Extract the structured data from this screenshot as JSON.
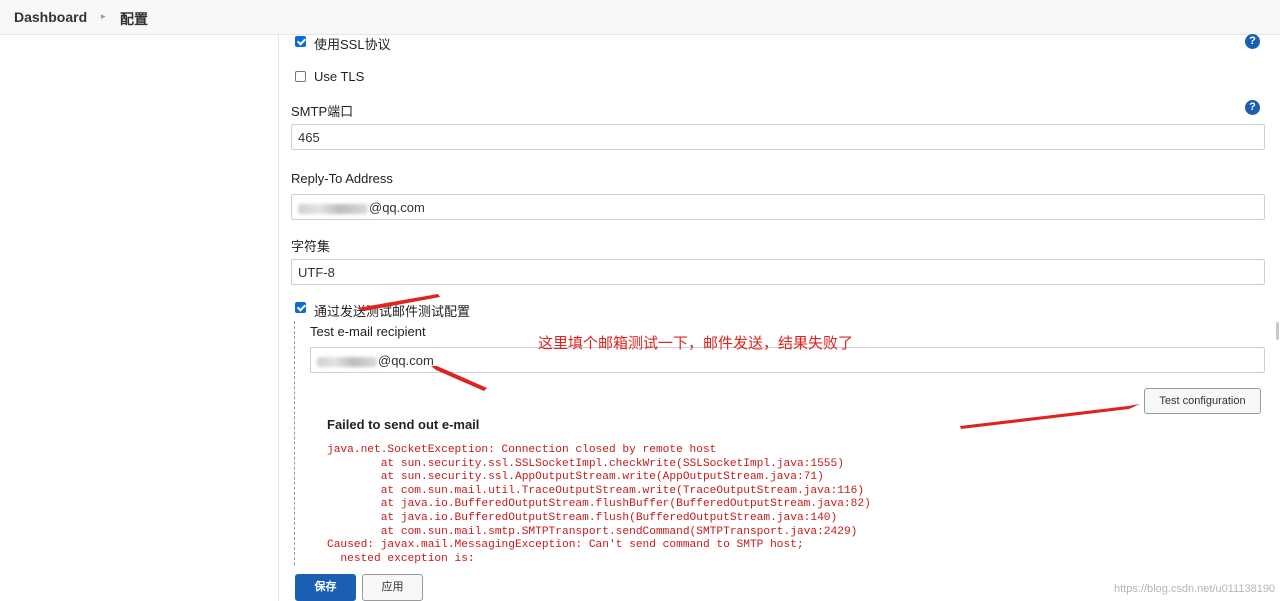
{
  "breadcrumb": {
    "dashboard": "Dashboard",
    "page": "配置"
  },
  "form": {
    "use_ssl_label": "使用SSL协议",
    "use_tls_label": "Use TLS",
    "smtp_port_label": "SMTP端口",
    "smtp_port_value": "465",
    "reply_to_label": "Reply-To Address",
    "reply_to_value_suffix": "@qq.com",
    "charset_label": "字符集",
    "charset_value": "UTF-8",
    "test_checkbox_label": "通过发送测试邮件测试配置",
    "test_recipient_label": "Test e-mail recipient",
    "test_recipient_value_suffix": "@qq.com",
    "test_button": "Test configuration",
    "help_icon": "?"
  },
  "annotation": "这里填个邮箱测试一下，邮件发送，结果失败了",
  "error": {
    "title": "Failed to send out e-mail",
    "lines": [
      "java.net.SocketException: Connection closed by remote host",
      "        at sun.security.ssl.SSLSocketImpl.checkWrite(SSLSocketImpl.java:1555)",
      "        at sun.security.ssl.AppOutputStream.write(AppOutputStream.java:71)",
      "        at com.sun.mail.util.TraceOutputStream.write(TraceOutputStream.java:116)",
      "        at java.io.BufferedOutputStream.flushBuffer(BufferedOutputStream.java:82)",
      "        at java.io.BufferedOutputStream.flush(BufferedOutputStream.java:140)",
      "        at com.sun.mail.smtp.SMTPTransport.sendCommand(SMTPTransport.java:2429)",
      "Caused: javax.mail.MessagingException: Can't send command to SMTP host;",
      "  nested exception is:"
    ]
  },
  "buttons": {
    "save": "保存",
    "apply": "应用"
  },
  "watermark": "https://blog.csdn.net/u011138190",
  "colors": {
    "accent": "#1a5fb4",
    "error": "#c61a1a",
    "annotation": "#e0231e"
  }
}
